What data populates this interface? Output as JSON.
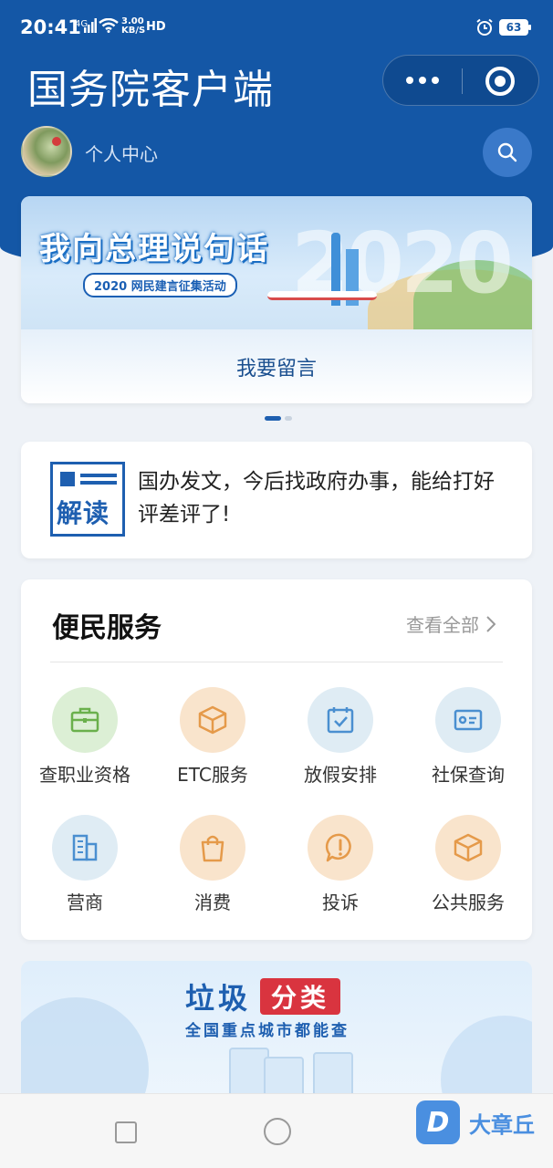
{
  "status_bar": {
    "time": "20:41",
    "network": "4G",
    "speed_value": "3.00",
    "speed_unit": "KB/S",
    "hd": "HD",
    "battery": "63"
  },
  "header": {
    "title": "国务院客户端",
    "user_label": "个人中心"
  },
  "banner": {
    "headline": "我向总理说句话",
    "subtitle": "2020 网民建言征集活动",
    "year_art": "2020",
    "action_label": "我要留言"
  },
  "carousel": {
    "total": 2,
    "active": 1
  },
  "news": {
    "badge_text": "解读",
    "text": "国办发文，今后找政府办事，能给打好评差评了!"
  },
  "services": {
    "title": "便民服务",
    "view_all": "查看全部",
    "items": [
      {
        "label": "查职业资格",
        "icon": "briefcase-icon",
        "tint": "green"
      },
      {
        "label": "ETC服务",
        "icon": "box-icon",
        "tint": "orange"
      },
      {
        "label": "放假安排",
        "icon": "calendar-check-icon",
        "tint": "blue"
      },
      {
        "label": "社保查询",
        "icon": "id-card-icon",
        "tint": "blue"
      },
      {
        "label": "营商",
        "icon": "building-icon",
        "tint": "blue"
      },
      {
        "label": "消费",
        "icon": "shopping-bag-icon",
        "tint": "orange"
      },
      {
        "label": "投诉",
        "icon": "alert-bubble-icon",
        "tint": "orange"
      },
      {
        "label": "公共服务",
        "icon": "box-icon",
        "tint": "orange"
      }
    ]
  },
  "promo": {
    "title": "垃圾",
    "tag": "分类",
    "subtitle": "全国重点城市都能查"
  },
  "watermark": {
    "logo_letter": "D",
    "text": "大章丘"
  },
  "colors": {
    "header_blue": "#1457a6",
    "accent_blue": "#1e5fb0",
    "promo_red": "#d9343f"
  }
}
